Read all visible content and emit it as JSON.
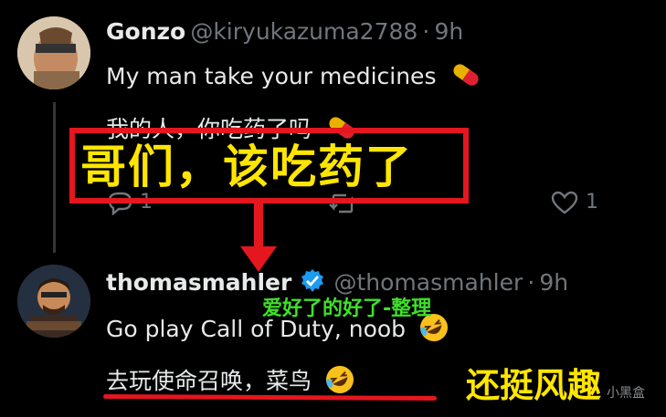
{
  "tweet1": {
    "name": "Gonzo",
    "handle": "@kiryukazuma2788",
    "sep": "·",
    "time": "9h",
    "line1": "My man take your medicines",
    "line2": "我的人，你吃药了吗",
    "reply_count": "1",
    "like_count": "1"
  },
  "tweet2": {
    "name": "thomasmahler",
    "handle": "@thomasmahler",
    "sep": "·",
    "time": "9h",
    "line1": "Go play Call of Duty, noob",
    "line2": "去玩使命召唤，菜鸟"
  },
  "overlay": {
    "boxed_text": "哥们，该吃药了",
    "green_caption": "爱好了的好了-整理",
    "yellow_caption": "还挺风趣",
    "watermark": "小黑盒"
  },
  "colors": {
    "accent_red": "#e4161e",
    "caption_yellow": "#ffe600",
    "caption_green": "#3fe02a",
    "verified_blue": "#1d9bf0",
    "muted_gray": "#71767b"
  },
  "icons": {
    "pill": "pill-emoji",
    "laugh": "rolling-on-floor-laughing-emoji",
    "verified": "verified-badge-icon",
    "reply": "reply-icon",
    "repost": "repost-icon",
    "like": "heart-icon"
  }
}
